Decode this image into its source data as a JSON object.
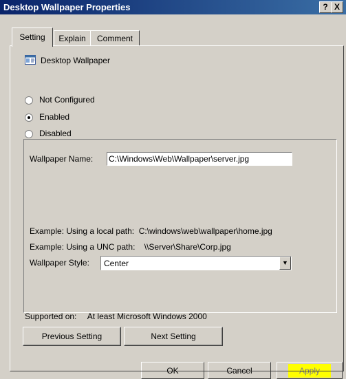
{
  "window": {
    "title": "Desktop Wallpaper Properties",
    "help_glyph": "?",
    "close_glyph": "X"
  },
  "tabs": [
    {
      "label": "Setting",
      "active": true
    },
    {
      "label": "Explain",
      "active": false
    },
    {
      "label": "Comment",
      "active": false
    }
  ],
  "policy": {
    "name": "Desktop Wallpaper",
    "icon": "policy-settings-icon"
  },
  "state": {
    "options": [
      {
        "label": "Not Configured",
        "checked": false
      },
      {
        "label": "Enabled",
        "checked": true
      },
      {
        "label": "Disabled",
        "checked": false
      }
    ]
  },
  "options_panel": {
    "wallpaper_name_label": "Wallpaper Name:",
    "wallpaper_name_value": "C:\\Windows\\Web\\Wallpaper\\server.jpg",
    "example_local": "Example: Using a local path:  C:\\windows\\web\\wallpaper\\home.jpg",
    "example_unc": "Example: Using a UNC path:    \\\\Server\\Share\\Corp.jpg",
    "wallpaper_style_label": "Wallpaper Style:",
    "wallpaper_style_value": "Center"
  },
  "supported": {
    "label": "Supported on:",
    "value": "At least Microsoft Windows 2000"
  },
  "navigation": {
    "previous": "Previous Setting",
    "next": "Next Setting"
  },
  "footer": {
    "ok": "OK",
    "cancel": "Cancel",
    "apply": "Apply",
    "apply_highlight_color": "#ffff00"
  },
  "colors": {
    "title_bar_start": "#0a246a",
    "title_bar_end": "#3a6ea5",
    "dialog_face": "#d4d0c8"
  }
}
